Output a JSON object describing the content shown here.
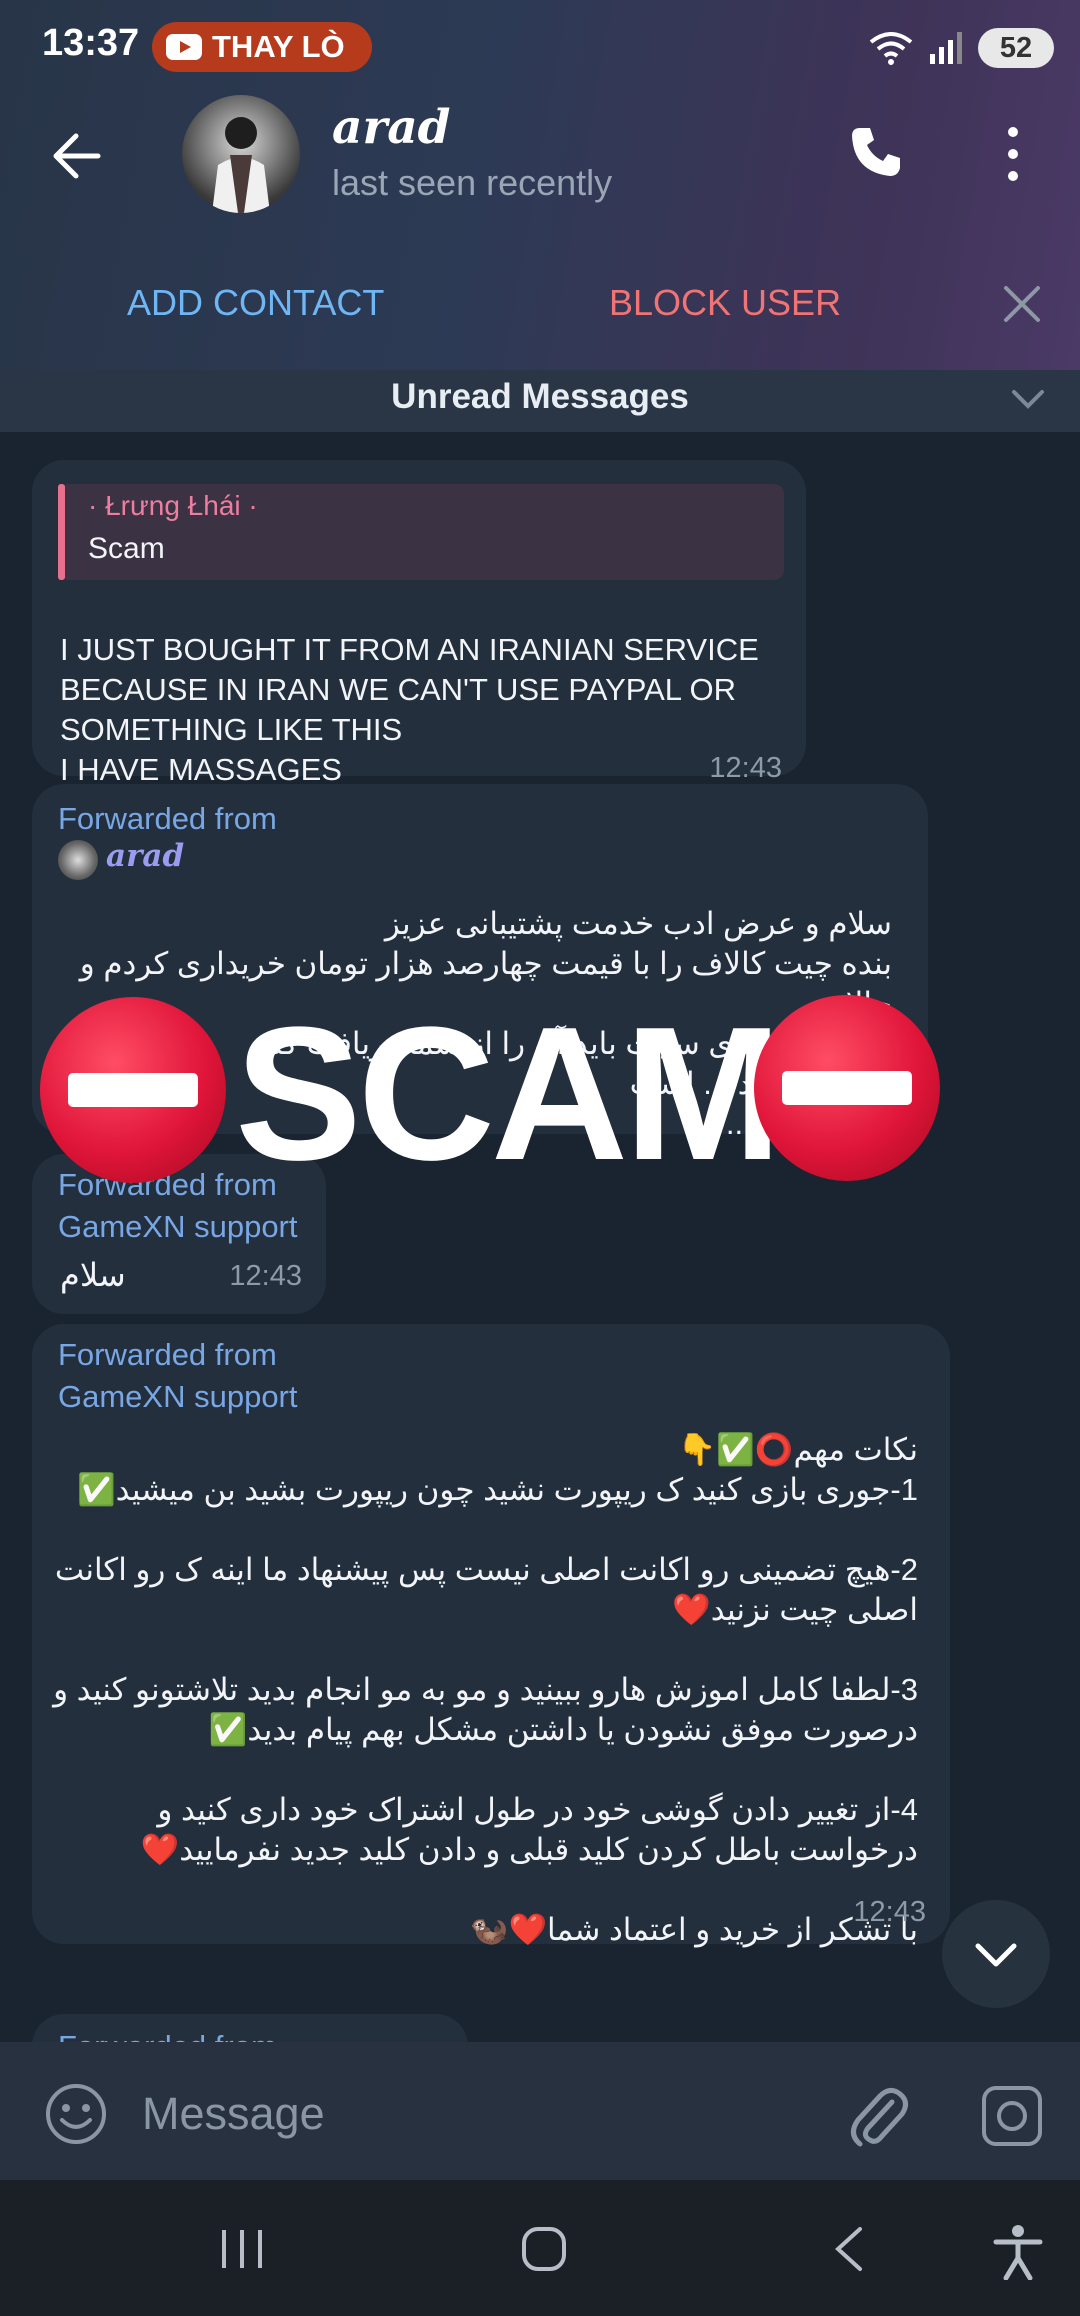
{
  "status_bar": {
    "time": "13:37",
    "notification_pill": "THAY LÒ",
    "battery": "52"
  },
  "header": {
    "contact_name": "arad",
    "status": "last seen recently",
    "actions": {
      "add_contact": "ADD CONTACT",
      "block_user": "BLOCK USER"
    }
  },
  "unread_banner": "Unread Messages",
  "messages": [
    {
      "reply_sender": "· Łrưng Łhái ·",
      "reply_text": "Scam",
      "lines": [
        "I JUST BOUGHT IT FROM AN IRANIAN SERVICE",
        "BECAUSE IN IRAN WE CAN'T USE PAYPAL OR",
        "SOMETHING LIKE THIS",
        "I HAVE MASSAGES"
      ],
      "time": "12:43"
    },
    {
      "forwarded_label": "Forwarded from",
      "forwarded_name": "arad",
      "lines": [
        "سلام و عرض ادب خدمت پشتیبانی عزیز",
        "بنده چیت کالاف را با قیمت چهارصد هزار تومان خریداری کردم و حالا",
        "طبق گفته های سایت باید آن را از شما دریافت کنم",
        "شماره خرید ... است",
        "... پاسخگو ..."
      ]
    },
    {
      "forwarded_label": "Forwarded from",
      "forwarded_name": "GameXN support",
      "text": "سلام",
      "time": "12:43"
    },
    {
      "forwarded_label": "Forwarded from",
      "forwarded_name": "GameXN support",
      "lines": [
        "نکات مهم⭕✅👇",
        "1-جوری بازی کنید ک ریپورت نشید چون ریپورت بشید بن میشید✅",
        "",
        "2-هیچ تضمینی رو اکانت اصلی نیست پس پیشنهاد ما اینه ک رو اکانت",
        "اصلی چیت نزنید❤️",
        "",
        "3-لطفا کامل اموزش هارو ببینید و مو به مو انجام بدید تلاشتونو کنید و",
        "درصورت موفق نشودن یا داشتن مشکل بهم پیام بدید✅",
        "",
        "4-از تغییر دادن گوشی خود در طول اشتراک خود داری کنید و",
        "درخواست باطل کردن کلید قبلی و دادن کلید جدید نفرمایید❤️",
        "",
        "با تشکر از خرید و اعتماد شما❤️🦦"
      ],
      "time": "12:43"
    },
    {
      "forwarded_label": "Forwarded from"
    }
  ],
  "overlay_text": "SCAM",
  "input": {
    "placeholder": "Message"
  },
  "colors": {
    "accent_blue": "#6fb6f5",
    "danger_red": "#f07474",
    "bubble": "#232f3d",
    "background": "#1a2330"
  }
}
